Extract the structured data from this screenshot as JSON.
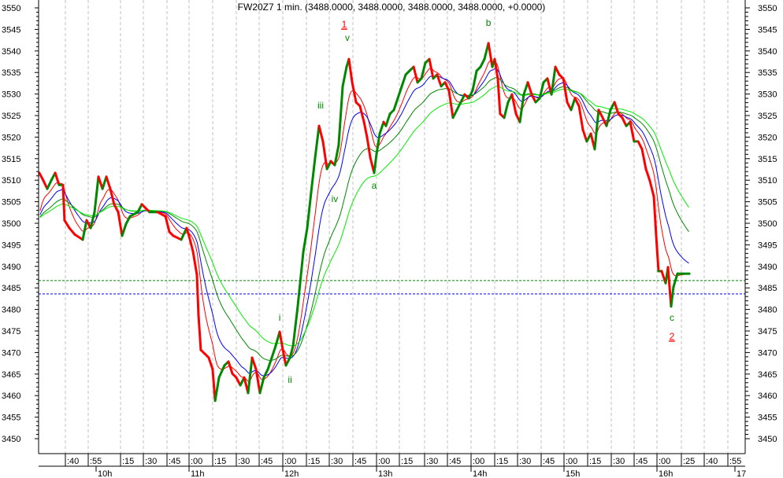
{
  "chart_data": {
    "type": "line",
    "title": "FW20Z7 1 min. (3488.0000, 3488.0000, 3488.0000, 3488.0000, +0.0000)",
    "x_unit": "minutes from 10:00",
    "ylim": [
      3450,
      3550
    ],
    "y_ticks": [
      3550,
      3545,
      3540,
      3535,
      3530,
      3525,
      3520,
      3515,
      3510,
      3505,
      3500,
      3495,
      3490,
      3485,
      3480,
      3475,
      3470,
      3465,
      3460,
      3455,
      3450
    ],
    "x_minor_labels": [
      ":40",
      ":55",
      ":15",
      ":30",
      ":45",
      ":00",
      ":15",
      ":30",
      ":45",
      ":00",
      ":15",
      ":30",
      ":45",
      ":00",
      ":15",
      ":30",
      ":45",
      ":00",
      ":15",
      ":30",
      ":45",
      ":00",
      ":15",
      ":30",
      ":45",
      ":00",
      ":25",
      ":40",
      ":55"
    ],
    "x_hour_labels": [
      "10h",
      "11h",
      "12h",
      "13h",
      "14h",
      "15h",
      "16h",
      "17"
    ],
    "grid": true,
    "colors": {
      "up": "#008800",
      "down": "#ff0000",
      "ma_fast": "#ff0000",
      "ma_mid": "#0000ff",
      "ma_slow": "#008800",
      "ma_slowest": "#00ee00",
      "level_green": "#008800",
      "level_blue": "#0000ff"
    },
    "price": [
      [
        -36.5,
        3511.7
      ],
      [
        -33.9,
        3509.9
      ],
      [
        -31.4,
        3508.0
      ],
      [
        -28.9,
        3509.9
      ],
      [
        -26.3,
        3511.7
      ],
      [
        -23.8,
        3508.9
      ],
      [
        -21.3,
        3508.9
      ],
      [
        -20.3,
        3500.7
      ],
      [
        -17.2,
        3498.9
      ],
      [
        -13.7,
        3497.4
      ],
      [
        -8.6,
        3496.2
      ],
      [
        -6.1,
        3500.7
      ],
      [
        -3.5,
        3498.9
      ],
      [
        -1.0,
        3502.6
      ],
      [
        1.5,
        3510.8
      ],
      [
        4.1,
        3508.0
      ],
      [
        6.6,
        3510.8
      ],
      [
        9.1,
        3508.0
      ],
      [
        11.6,
        3504.4
      ],
      [
        14.2,
        3502.6
      ],
      [
        16.7,
        3497.1
      ],
      [
        19.2,
        3499.8
      ],
      [
        21.8,
        3501.6
      ],
      [
        26.8,
        3502.6
      ],
      [
        29.4,
        3504.4
      ],
      [
        34.4,
        3502.6
      ],
      [
        39.5,
        3502.6
      ],
      [
        44.6,
        3501.6
      ],
      [
        47.1,
        3498.0
      ],
      [
        49.6,
        3497.1
      ],
      [
        54.7,
        3496.2
      ],
      [
        58.2,
        3498.9
      ],
      [
        59.7,
        3497.1
      ],
      [
        62.3,
        3493.4
      ],
      [
        64.8,
        3488.0
      ],
      [
        65.8,
        3478.8
      ],
      [
        67.3,
        3470.6
      ],
      [
        69.9,
        3469.7
      ],
      [
        72.4,
        3468.8
      ],
      [
        74.9,
        3466.1
      ],
      [
        76.5,
        3458.8
      ],
      [
        79.0,
        3464.2
      ],
      [
        82.5,
        3467.0
      ],
      [
        85.1,
        3467.9
      ],
      [
        87.6,
        3465.1
      ],
      [
        90.1,
        3464.2
      ],
      [
        92.7,
        3462.4
      ],
      [
        95.2,
        3464.2
      ],
      [
        97.7,
        3460.6
      ],
      [
        100.3,
        3468.8
      ],
      [
        102.8,
        3466.1
      ],
      [
        105.3,
        3460.6
      ],
      [
        107.8,
        3464.2
      ],
      [
        110.4,
        3466.1
      ],
      [
        112.9,
        3468.8
      ],
      [
        115.4,
        3471.5
      ],
      [
        118.0,
        3474.8
      ],
      [
        120.5,
        3469.7
      ],
      [
        122.0,
        3467.0
      ],
      [
        124.6,
        3468.8
      ],
      [
        126.6,
        3471.5
      ],
      [
        129.6,
        3480.7
      ],
      [
        133.2,
        3493.4
      ],
      [
        135.7,
        3498.9
      ],
      [
        138.2,
        3507.1
      ],
      [
        140.8,
        3515.3
      ],
      [
        143.3,
        3522.6
      ],
      [
        145.8,
        3519.0
      ],
      [
        148.4,
        3512.6
      ],
      [
        150.9,
        3514.4
      ],
      [
        153.4,
        3513.5
      ],
      [
        155.9,
        3518.1
      ],
      [
        158.5,
        3531.8
      ],
      [
        161.0,
        3536.3
      ],
      [
        162.5,
        3538.1
      ],
      [
        164.6,
        3532.7
      ],
      [
        167.1,
        3528.1
      ],
      [
        169.6,
        3527.2
      ],
      [
        172.2,
        3523.5
      ],
      [
        174.2,
        3519.9
      ],
      [
        176.2,
        3515.3
      ],
      [
        178.7,
        3511.7
      ],
      [
        180.3,
        3516.2
      ],
      [
        182.3,
        3520.8
      ],
      [
        184.8,
        3523.5
      ],
      [
        186.3,
        3522.6
      ],
      [
        188.9,
        3525.4
      ],
      [
        191.4,
        3526.3
      ],
      [
        193.9,
        3529.0
      ],
      [
        196.5,
        3531.8
      ],
      [
        199.0,
        3534.5
      ],
      [
        201.5,
        3535.4
      ],
      [
        204.1,
        3536.3
      ],
      [
        206.6,
        3532.7
      ],
      [
        209.1,
        3533.6
      ],
      [
        211.6,
        3537.2
      ],
      [
        214.2,
        3538.1
      ],
      [
        216.7,
        3533.6
      ],
      [
        219.2,
        3534.5
      ],
      [
        221.8,
        3531.8
      ],
      [
        224.3,
        3532.7
      ],
      [
        226.8,
        3530.8
      ],
      [
        229.4,
        3524.5
      ],
      [
        231.9,
        3526.3
      ],
      [
        234.4,
        3528.1
      ],
      [
        236.9,
        3529.9
      ],
      [
        239.5,
        3529.0
      ],
      [
        242.0,
        3530.8
      ],
      [
        244.6,
        3535.4
      ],
      [
        247.1,
        3536.3
      ],
      [
        249.6,
        3538.1
      ],
      [
        252.2,
        3541.8
      ],
      [
        254.7,
        3536.3
      ],
      [
        256.2,
        3538.1
      ],
      [
        258.2,
        3533.6
      ],
      [
        259.7,
        3525.4
      ],
      [
        262.3,
        3524.5
      ],
      [
        264.8,
        3528.1
      ],
      [
        267.3,
        3529.9
      ],
      [
        269.9,
        3525.4
      ],
      [
        272.4,
        3523.5
      ],
      [
        274.9,
        3529.9
      ],
      [
        277.5,
        3532.7
      ],
      [
        280.0,
        3529.9
      ],
      [
        282.5,
        3528.1
      ],
      [
        285.1,
        3529.0
      ],
      [
        287.6,
        3532.7
      ],
      [
        290.1,
        3533.6
      ],
      [
        292.7,
        3529.9
      ],
      [
        295.2,
        3536.3
      ],
      [
        297.7,
        3534.5
      ],
      [
        300.3,
        3533.6
      ],
      [
        302.8,
        3528.1
      ],
      [
        305.3,
        3526.3
      ],
      [
        307.8,
        3529.0
      ],
      [
        310.4,
        3527.2
      ],
      [
        312.9,
        3521.7
      ],
      [
        315.4,
        3519.0
      ],
      [
        318.0,
        3520.8
      ],
      [
        320.5,
        3517.2
      ],
      [
        323.0,
        3526.3
      ],
      [
        325.6,
        3524.5
      ],
      [
        328.1,
        3522.6
      ],
      [
        330.6,
        3526.3
      ],
      [
        333.2,
        3528.1
      ],
      [
        335.7,
        3525.4
      ],
      [
        338.2,
        3524.5
      ],
      [
        340.8,
        3522.6
      ],
      [
        343.3,
        3523.5
      ],
      [
        345.8,
        3519.0
      ],
      [
        348.4,
        3519.0
      ],
      [
        350.9,
        3517.2
      ],
      [
        353.4,
        3512.6
      ],
      [
        355.9,
        3509.9
      ],
      [
        358.5,
        3506.2
      ],
      [
        360.0,
        3497.1
      ],
      [
        361.5,
        3488.9
      ],
      [
        363.5,
        3488.9
      ],
      [
        366.1,
        3486.1
      ],
      [
        367.6,
        3489.8
      ],
      [
        369.6,
        3480.7
      ],
      [
        371.1,
        3485.2
      ],
      [
        373.7,
        3488.3
      ],
      [
        381.3,
        3488.3
      ]
    ],
    "moving_average_periods": [
      10,
      20,
      40,
      60
    ],
    "levels": [
      {
        "value": 3486.7,
        "color": "#008800"
      },
      {
        "value": 3483.6,
        "color": "#0000ff"
      }
    ],
    "annotations": [
      {
        "text": "1",
        "x": 159.5,
        "y": 3545.4,
        "color": "#ff0000",
        "underline": true
      },
      {
        "text": "v",
        "x": 161.5,
        "y": 3542.3,
        "color": "#008800"
      },
      {
        "text": "iii",
        "x": 144.3,
        "y": 3526.6,
        "color": "#008800"
      },
      {
        "text": "iv",
        "x": 153.4,
        "y": 3504.9,
        "color": "#008800"
      },
      {
        "text": "a",
        "x": 178.7,
        "y": 3508.0,
        "color": "#008800"
      },
      {
        "text": "b",
        "x": 252.2,
        "y": 3545.8,
        "color": "#008800"
      },
      {
        "text": "i",
        "x": 118.0,
        "y": 3477.4,
        "color": "#008800"
      },
      {
        "text": "ii",
        "x": 124.6,
        "y": 3463.0,
        "color": "#008800"
      },
      {
        "text": "c",
        "x": 370.1,
        "y": 3477.4,
        "color": "#008800"
      },
      {
        "text": "2",
        "x": 370.1,
        "y": 3473.0,
        "color": "#ff0000",
        "underline": true
      }
    ]
  }
}
